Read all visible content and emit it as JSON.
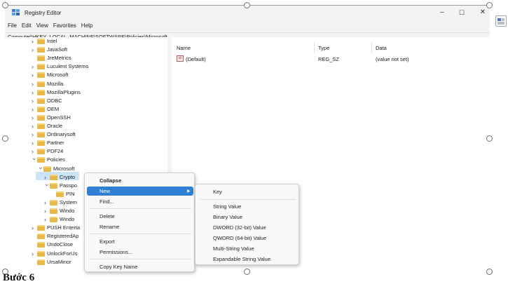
{
  "window": {
    "title": "Registry Editor",
    "controls": {
      "minimize": "–",
      "maximize": "☐",
      "close": "✕"
    }
  },
  "menu": [
    "File",
    "Edit",
    "View",
    "Favorites",
    "Help"
  ],
  "address": "Computer\\HKEY_LOCAL_MACHINE\\SOFTWARE\\Policies\\Microsoft",
  "tree": {
    "items": [
      {
        "label": "Intel",
        "expanded": false
      },
      {
        "label": "JavaSoft",
        "expanded": false
      },
      {
        "label": "JreMetrics",
        "expanded": null
      },
      {
        "label": "Luculent Systems",
        "expanded": false
      },
      {
        "label": "Microsoft",
        "expanded": false
      },
      {
        "label": "Mozilla",
        "expanded": false
      },
      {
        "label": "MozillaPlugins",
        "expanded": false
      },
      {
        "label": "ODBC",
        "expanded": false
      },
      {
        "label": "OEM",
        "expanded": false
      },
      {
        "label": "OpenSSH",
        "expanded": false
      },
      {
        "label": "Oracle",
        "expanded": false
      },
      {
        "label": "Ordinarysoft",
        "expanded": false
      },
      {
        "label": "Partner",
        "expanded": false
      },
      {
        "label": "PDF24",
        "expanded": false
      },
      {
        "label": "Policies",
        "expanded": true
      },
      {
        "label": "Microsoft",
        "expanded": true,
        "selected": true
      },
      {
        "label": "Crypto",
        "expanded": false
      },
      {
        "label": "Passpo",
        "expanded": true
      },
      {
        "label": "PIN",
        "expanded": null
      },
      {
        "label": "System",
        "expanded": false
      },
      {
        "label": "Windo",
        "expanded": false
      },
      {
        "label": "Windo",
        "expanded": false
      },
      {
        "label": "PUSH Enterta",
        "expanded": false
      },
      {
        "label": "RegisteredAp",
        "expanded": null
      },
      {
        "label": "UndoClose",
        "expanded": null
      },
      {
        "label": "UnlockForUs",
        "expanded": false
      },
      {
        "label": "UrsaMinor",
        "expanded": null
      }
    ]
  },
  "values": {
    "columns": [
      "Name",
      "Type",
      "Data"
    ],
    "rows": [
      {
        "name": "(Default)",
        "type": "REG_SZ",
        "data": "(value not set)",
        "icon": "ab"
      }
    ]
  },
  "context_menu": {
    "items": [
      "Collapse",
      "New",
      "Find...",
      "Delete",
      "Rename",
      "Export",
      "Permissions...",
      "Copy Key Name"
    ],
    "highlighted": "New"
  },
  "submenu": {
    "items": [
      "Key",
      "String Value",
      "Binary Value",
      "DWORD (32-bit) Value",
      "QWORD (64-bit) Value",
      "Multi-String Value",
      "Expandable String Value"
    ]
  },
  "caption": "Bước 6",
  "colors": {
    "highlight": "#2f7fd6",
    "folder": "#e9b84a",
    "selection_tree": "#cce4f7"
  }
}
